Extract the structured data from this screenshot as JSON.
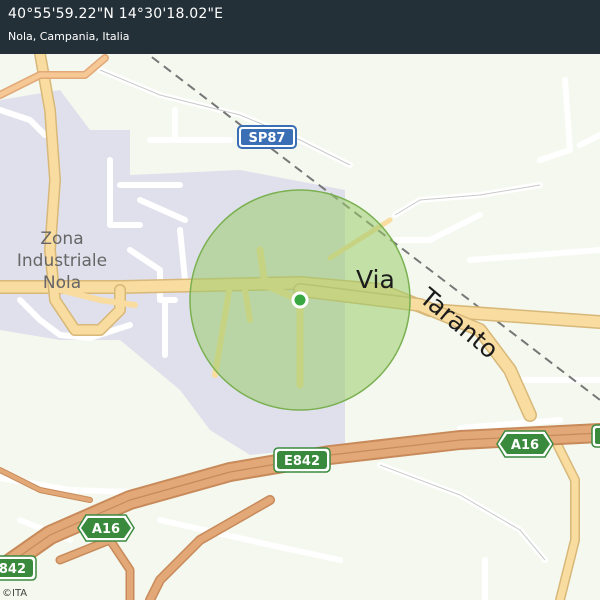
{
  "header": {
    "coordinates": "40°55'59.22\"N 14°30'18.02\"E",
    "place": "Nola, Campania, Italia"
  },
  "map": {
    "area_label": [
      "Zona",
      "Industriale",
      "Nola"
    ],
    "street_label_1": "Via",
    "street_label_2": "Taranto",
    "shields": {
      "sp87": "SP87",
      "a16_right": "A16",
      "a16_left": "A16",
      "e842_mid": "E842",
      "e842_left": "E842"
    },
    "colors": {
      "background": "#f4f8ee",
      "industrial": "#e0e0ec",
      "major_road": "#f8dca0",
      "motorway": "#e2a877",
      "accuracy_circle": "#9bcc6c",
      "location_dot": "#3aa841",
      "shield_motorway": "#3a8a3e",
      "shield_provincial": "#3b6fb5"
    },
    "location_marker": "location-dot"
  },
  "footer": {
    "copyright": "©ITA"
  }
}
